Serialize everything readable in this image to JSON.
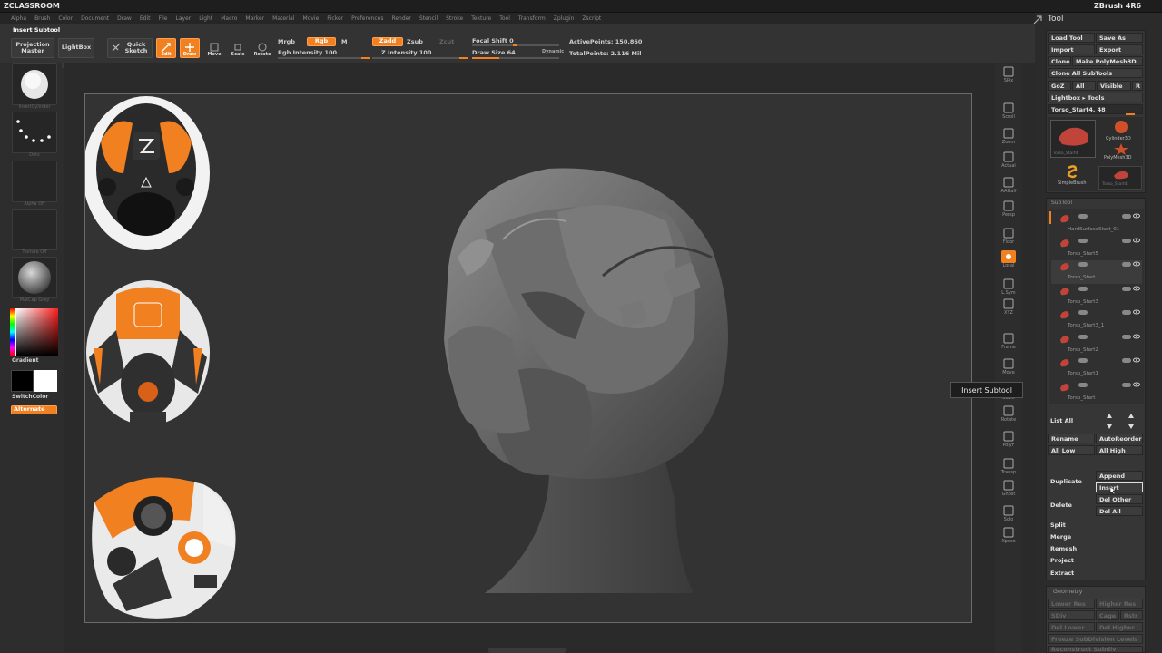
{
  "app": {
    "brand_left": "ZCLASSROOM",
    "brand_right": "ZBrush 4R6"
  },
  "menu": [
    "Alpha",
    "Brush",
    "Color",
    "Document",
    "Draw",
    "Edit",
    "File",
    "Layer",
    "Light",
    "Macro",
    "Marker",
    "Material",
    "Movie",
    "Picker",
    "Preferences",
    "Render",
    "Stencil",
    "Stroke",
    "Texture",
    "Tool",
    "Transform",
    "Zplugin",
    "Zscript"
  ],
  "status_title": "Insert Subtool",
  "toolbar": {
    "projection_master": "Projection Master",
    "lightbox": "LightBox",
    "quick_sketch": "Quick Sketch",
    "edit": "Edit",
    "draw": "Draw",
    "move": "Move",
    "scale": "Scale",
    "rotate": "Rotate",
    "mrgb": "Mrgb",
    "rgb": "Rgb",
    "m": "M",
    "rgb_intensity": "Rgb Intensity 100",
    "zadd": "Zadd",
    "zsub": "Zsub",
    "zcut": "Zcut",
    "z_intensity": "Z Intensity 100",
    "focal_shift": "Focal Shift 0",
    "draw_size": "Draw Size 64",
    "dynamic": "Dynamic",
    "active_points": "ActivePoints: 150,860",
    "total_points": "TotalPoints: 2.116 Mil"
  },
  "left_tray": {
    "brush_caption": "InsertCylinder",
    "stroke_caption": "Dots",
    "alpha_caption": "Alpha Off",
    "texture_caption": "Texture Off",
    "material_caption": "MatCap Gray",
    "gradient": "Gradient",
    "switch_color": "SwitchColor",
    "alternate": "Alternate"
  },
  "right_shelf": [
    "SPix",
    "Scroll",
    "Zoom",
    "Actual",
    "AAHalf",
    "Persp",
    "Floor",
    "Local",
    "L.Sym",
    "XYZ",
    "Frame",
    "Move",
    "Scale",
    "Rotate",
    "PolyF",
    "Transp",
    "Ghost",
    "Solo",
    "Xpose"
  ],
  "tool_panel": {
    "title": "Tool",
    "load_tool": "Load Tool",
    "save_as": "Save As",
    "import": "Import",
    "export": "Export",
    "clone": "Clone",
    "make_polymesh": "Make PolyMesh3D",
    "clone_all": "Clone All SubTools",
    "goz": "GoZ",
    "all": "All",
    "visible": "Visible",
    "r": "R",
    "lightbox_tools": "Lightbox ▸ Tools",
    "current_tool": "Torso_Start4. 48",
    "thumbs": [
      "Torso_Start4",
      "Cylinder3D",
      "SimpleBrush",
      "PolyMesh3D",
      "Torso_Start4"
    ],
    "subtool_header": "SubTool",
    "subtools": [
      "HardSurfaceStart_01",
      "Torso_Start5",
      "Torso_Start",
      "Torso_Start3",
      "Torso_Start3_1",
      "Torso_Start2",
      "Torso_Start1",
      "Torso_Start"
    ],
    "list_all": "List All",
    "rename": "Rename",
    "auto_reorder": "AutoReorder",
    "all_low": "All Low",
    "all_high": "All High",
    "duplicate": "Duplicate",
    "append": "Append",
    "insert": "Insert",
    "delete": "Delete",
    "del_other": "Del Other",
    "del_all": "Del All",
    "split": "Split",
    "merge": "Merge",
    "remesh": "Remesh",
    "project": "Project",
    "extract": "Extract",
    "geometry": "Geometry",
    "geo_lower_res": "Lower Res",
    "geo_higher_res": "Higher Res",
    "geo_sdiv": "SDiv",
    "geo_cage": "Cage",
    "geo_rstr": "Rstr",
    "geo_del_lower": "Del Lower",
    "geo_del_higher": "Del Higher",
    "geo_freeze": "Freeze SubDivision Levels",
    "geo_reconstruct": "Reconstruct Subdiv"
  },
  "tooltip": "Insert Subtool",
  "colors": {
    "accent": "#f08020",
    "bg": "#2a2a2a",
    "panel": "#333333"
  }
}
